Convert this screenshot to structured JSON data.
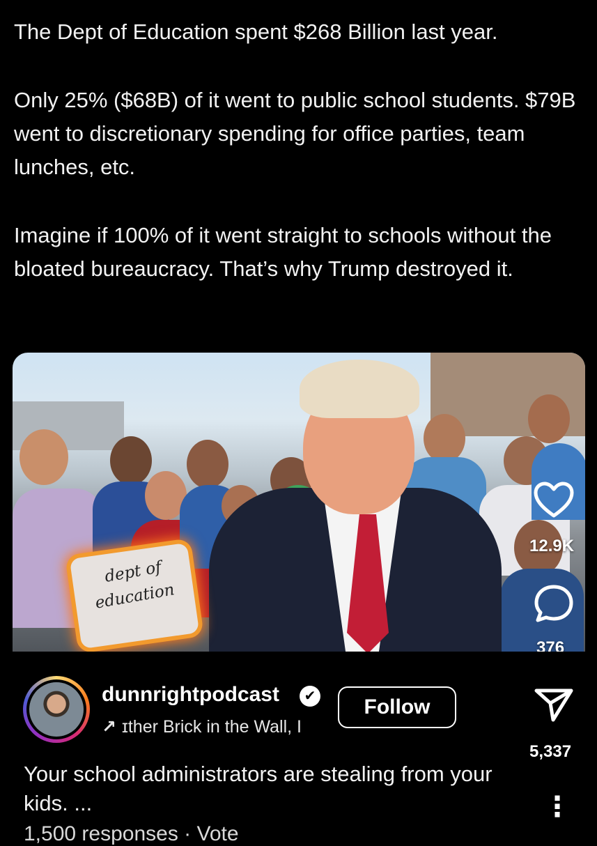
{
  "post": {
    "paragraphs": [
      "The Dept of Education spent $268 Billion last year.",
      "Only 25% ($68B) of it went to public school students. $79B went to discretionary spending for office parties, team lunches, etc.",
      "Imagine if 100% of it went straight to schools without the  bloated bureaucracy. That’s why Trump destroyed it."
    ]
  },
  "image": {
    "sign_line1": "dept of",
    "sign_line2": "education"
  },
  "actions": {
    "likes": "12.9K",
    "comments": "376",
    "shares": "5,337"
  },
  "reel": {
    "username": "dunnrightpodcast",
    "verified_mark": "✔",
    "music_arrow": "↗",
    "music_text": "ɪther Brick in the Wall, I",
    "follow_label": "Follow",
    "caption": "Your school administrators are stealing from your kids. ...",
    "responses": "1,500 responses · Vote",
    "more_icon": "⋮"
  },
  "icons": {
    "like": "heart-icon",
    "comment": "comment-icon",
    "share": "send-icon",
    "more": "more-vertical-icon"
  }
}
